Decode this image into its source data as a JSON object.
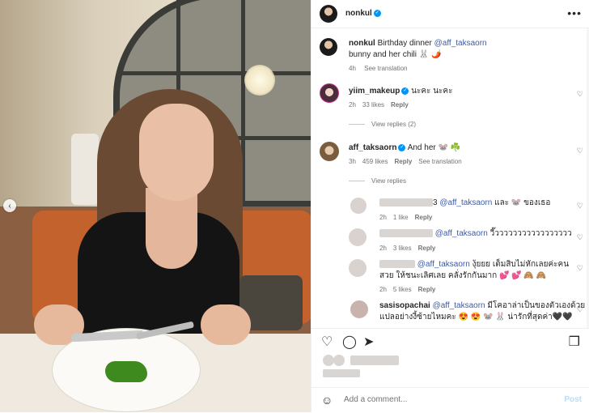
{
  "post_author": {
    "username": "nonkul"
  },
  "caption": {
    "username": "nonkul",
    "text_prefix": "Birthday dinner",
    "mention": "@aff_taksaorn",
    "line2": "bunny and her chili 🐰 🌶️",
    "time": "4h",
    "translation": "See translation"
  },
  "comments": [
    {
      "username": "yiim_makeup",
      "text": "นะคะ นะคะ",
      "time": "2h",
      "likes": "33 likes",
      "reply": "Reply",
      "view_replies": "View replies (2)"
    },
    {
      "username": "aff_taksaorn",
      "text": "And her 🐭 ☘️",
      "time": "3h",
      "likes": "459 likes",
      "reply": "Reply",
      "translation": "See translation",
      "view_replies": "View replies"
    }
  ],
  "replies": [
    {
      "mention": "@aff_taksaorn",
      "text": "และ 🐭 ของเธอ",
      "time": "2h",
      "likes": "1 like",
      "reply": "Reply",
      "prefix_visible": "3"
    },
    {
      "mention": "@aff_taksaorn",
      "text": "วี๊ววววววววววววววววว",
      "time": "2h",
      "likes": "3 likes",
      "reply": "Reply"
    },
    {
      "mention": "@aff_taksaorn",
      "text": "งุ้ยยย เต็มสิบไม่หักเลยค่ะคน",
      "line2": "สวย ให้ชนะเลิศเลย คลั่งรักกันมาก 💕 💕 🙈 🙈",
      "time": "2h",
      "likes": "5 likes",
      "reply": "Reply"
    },
    {
      "username": "sasisopachai",
      "mention": "@aff_taksaorn",
      "text": "มีโคอาล่าเป็นของตัวเองด้วย",
      "line2": "แปลอย่างงี้ซ้ายไหมคะ 😍 😍 🐭 🐰 น่ารักที่สุดค่า🖤🖤"
    }
  ],
  "actions": {
    "like_icon": "heart-icon",
    "comment_icon": "comment-icon",
    "share_icon": "share-icon",
    "save_icon": "bookmark-icon"
  },
  "add_comment": {
    "placeholder": "Add a comment...",
    "post_label": "Post"
  },
  "glyphs": {
    "more": "•••",
    "heart_outline": "♡",
    "verified": "✓",
    "chev_left": "‹",
    "emoji": "☺",
    "comment": "◯",
    "share": "➤",
    "save": "❒"
  }
}
